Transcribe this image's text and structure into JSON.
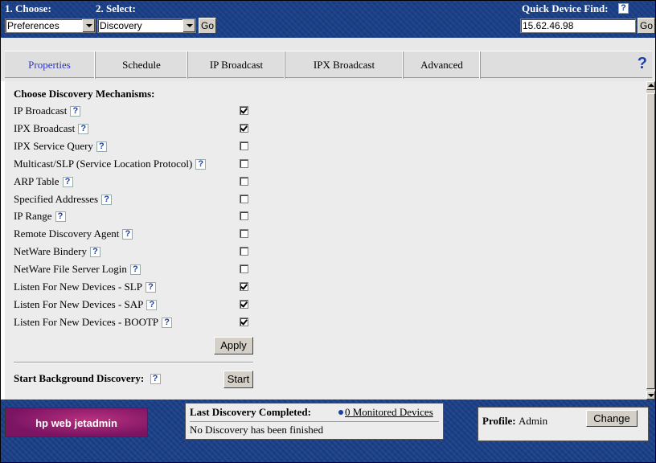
{
  "toolbar": {
    "choose_label": "1. Choose:",
    "choose_value": "Preferences",
    "select_label": "2. Select:",
    "select_value": "Discovery",
    "go_label": "Go",
    "quick_find_label": "Quick Device Find:",
    "quick_find_value": "15.62.46.98",
    "quick_go_label": "Go",
    "help_glyph": "?"
  },
  "tabs": [
    {
      "label": "Properties",
      "active": true
    },
    {
      "label": "Schedule",
      "active": false
    },
    {
      "label": "IP Broadcast",
      "active": false
    },
    {
      "label": "IPX Broadcast",
      "active": false
    },
    {
      "label": "Advanced",
      "active": false
    }
  ],
  "page_help_glyph": "?",
  "discovery": {
    "heading": "Choose Discovery Mechanisms:",
    "mechanisms": [
      {
        "label": "IP Broadcast",
        "checked": true
      },
      {
        "label": "IPX Broadcast",
        "checked": true
      },
      {
        "label": "IPX Service Query",
        "checked": false
      },
      {
        "label": "Multicast/SLP (Service Location Protocol)",
        "checked": false
      },
      {
        "label": "ARP Table",
        "checked": false
      },
      {
        "label": "Specified Addresses",
        "checked": false
      },
      {
        "label": "IP Range",
        "checked": false
      },
      {
        "label": "Remote Discovery Agent",
        "checked": false
      },
      {
        "label": "NetWare Bindery",
        "checked": false
      },
      {
        "label": "NetWare File Server Login",
        "checked": false
      },
      {
        "label": "Listen For New Devices - SLP",
        "checked": true
      },
      {
        "label": "Listen For New Devices - SAP",
        "checked": true
      },
      {
        "label": "Listen For New Devices - BOOTP",
        "checked": true
      }
    ],
    "apply_label": "Apply",
    "background_label": "Start Background Discovery:",
    "start_label": "Start"
  },
  "footer": {
    "logo_text": "hp web jetadmin",
    "last_title": "Last Discovery Completed:",
    "monitored_link": "0 Monitored Devices",
    "last_status": "No Discovery has been finished",
    "profile_label": "Profile:",
    "profile_value": "Admin",
    "change_label": "Change"
  },
  "colors": {
    "banner_blue": "#1a3f87",
    "active_tab": "#3136c2",
    "help_blue": "#1b3fa8",
    "logo_magenta": "#7a1463"
  }
}
